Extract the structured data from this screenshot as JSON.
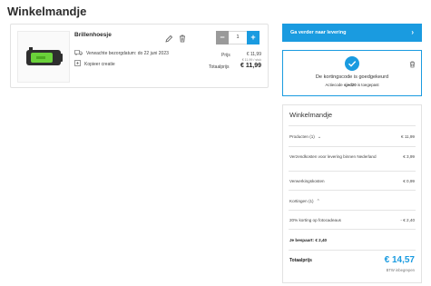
{
  "page": {
    "title": "Winkelmandje"
  },
  "product": {
    "name": "Brillenhoesje",
    "delivery_text": "Verwachte bezorgdatum: do 22 juni 2023",
    "copy_label": "Kopieer creatie",
    "quantity": "1",
    "minus_label": "−",
    "plus_label": "+",
    "price_label": "Prijs",
    "price_value": "€ 11,99",
    "unit_price": "€ 11,99 / stuk",
    "total_label": "Totaalprijs",
    "total_value": "€ 11,99",
    "thumb_color": "#6ad13a"
  },
  "cta": {
    "label": "Ga verder naar levering",
    "chevron": "›",
    "color": "#1a9be0"
  },
  "coupon": {
    "title": "De kortingscode is goedgekeurd",
    "sub_prefix": "Actiecode ",
    "code": "sjed20",
    "sub_suffix": " is toegepast"
  },
  "summary": {
    "title": "Winkelmandje",
    "products_label": "Producten (1)",
    "products_value": "€ 11,99",
    "shipping_label": "Verzendkosten voor levering binnen Nederland",
    "shipping_value": "€ 3,99",
    "handling_label": "Verwerkingskosten",
    "handling_value": "€ 0,99",
    "discounts_label": "Kortingen (1)",
    "discount_item_label": "20% korting op fotocadeaus",
    "discount_item_value": "- € 2,40",
    "saved_label": "Je bespaart: € 2,40",
    "total_label": "Totaalprijs",
    "total_value": "€ 14,57",
    "vat_note": "BTW inbegrepen"
  }
}
